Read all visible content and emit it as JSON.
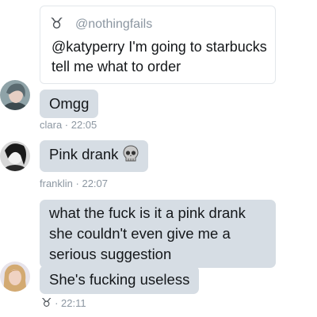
{
  "quote": {
    "icon": "taurus-icon",
    "handle": "@nothingfails",
    "text": "@katyperry I'm going to starbucks tell me what to order"
  },
  "messages": [
    {
      "text": "Omgg",
      "meta": "clara · 22:05",
      "avatar": "avatar-clara"
    },
    {
      "text": "Pink drank",
      "emoji": "skull-icon",
      "meta": "franklin · 22:07",
      "avatar": "avatar-franklin"
    },
    {
      "text": "what the fuck is it a pink drank she couldn't even give me a serious suggestion"
    },
    {
      "text": "She's fucking useless",
      "meta_time": "22:11",
      "meta_sep": "·",
      "avatar": "avatar-third"
    }
  ],
  "colors": {
    "bubble": "#d6dde4",
    "meta_text": "#8b96a1",
    "quote_border": "#e3e7eb"
  }
}
